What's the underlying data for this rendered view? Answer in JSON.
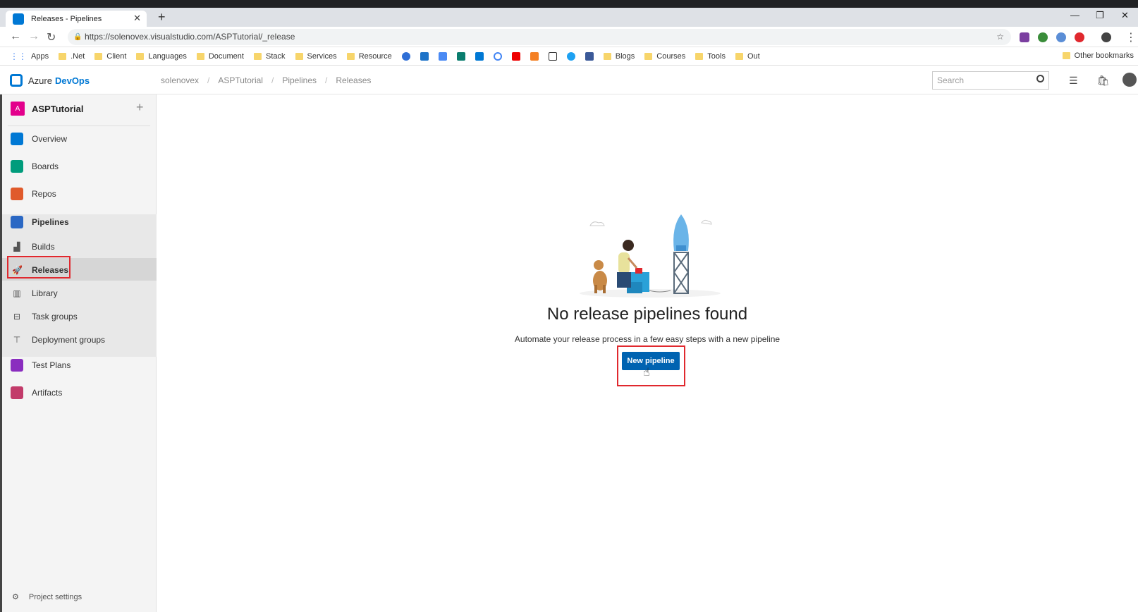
{
  "browser": {
    "tab_title": "Releases - Pipelines",
    "tab_close": "✕",
    "new_tab": "+",
    "url": "https://solenovex.visualstudio.com/ASPTutorial/_release",
    "bookmarks": [
      "Apps",
      ".Net",
      "Client",
      "Languages",
      "Document",
      "Stack",
      "Services",
      "Resource",
      "Blogs",
      "Courses",
      "Tools",
      "Out"
    ],
    "other_bookmarks": "Other bookmarks"
  },
  "header": {
    "brand_prefix": "Azure",
    "brand_suffix": "DevOps",
    "breadcrumb": [
      "solenovex",
      "ASPTutorial",
      "Pipelines",
      "Releases"
    ],
    "search_placeholder": "Search"
  },
  "sidebar": {
    "project_badge": "A",
    "project_name": "ASPTutorial",
    "items": [
      {
        "label": "Overview",
        "color": "#0078d4"
      },
      {
        "label": "Boards",
        "color": "#009c7c"
      },
      {
        "label": "Repos",
        "color": "#e05a2b"
      },
      {
        "label": "Pipelines",
        "color": "#2b68c4"
      },
      {
        "label": "Test Plans",
        "color": "#8a2dbf"
      },
      {
        "label": "Artifacts",
        "color": "#c23b6a"
      }
    ],
    "subitems": [
      "Builds",
      "Releases",
      "Library",
      "Task groups",
      "Deployment groups"
    ],
    "settings": "Project settings"
  },
  "main": {
    "empty_title": "No release pipelines found",
    "empty_subtitle": "Automate your release process in a few easy steps with a new pipeline",
    "new_pipeline_button": "New pipeline"
  },
  "colors": {
    "accent": "#0078d4",
    "button": "#0063b1",
    "highlight_box": "#e0282e"
  }
}
